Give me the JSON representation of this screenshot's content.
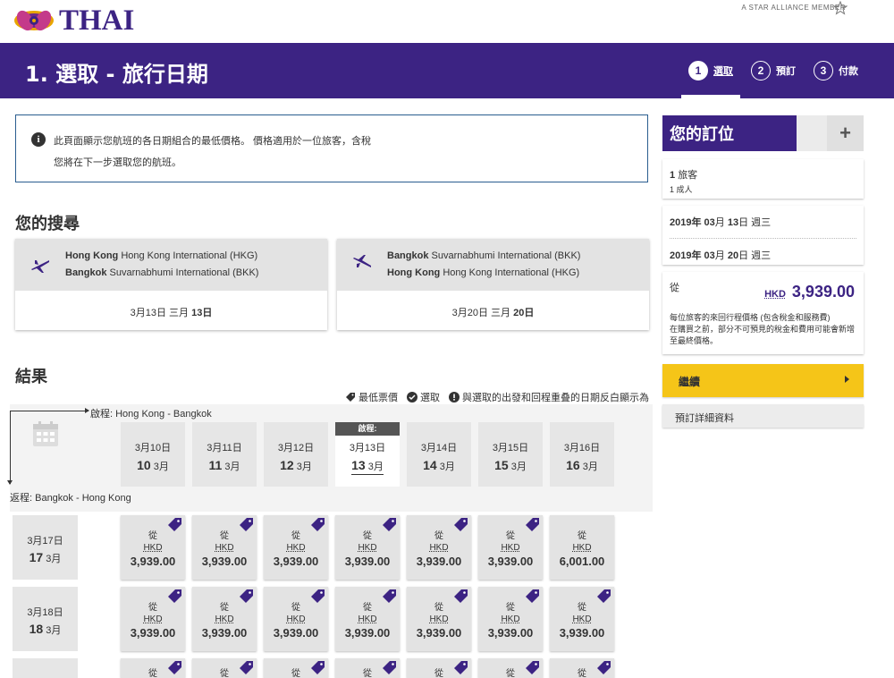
{
  "brand": {
    "name": "THAI",
    "alliance": "A STAR ALLIANCE MEMBER"
  },
  "header": {
    "title": "1. 選取 - 旅行日期",
    "steps": [
      {
        "num": "1",
        "label": "選取"
      },
      {
        "num": "2",
        "label": "預訂"
      },
      {
        "num": "3",
        "label": "付款"
      }
    ]
  },
  "info": {
    "line1": "此頁面顯示您航班的各日期組合的最低價格。 價格適用於一位旅客，含稅",
    "line2": "您將在下一步選取您的航班。"
  },
  "search": {
    "title": "您的搜尋",
    "outbound": {
      "from_city": "Hong Kong",
      "from_airport": "Hong Kong International (HKG)",
      "to_city": "Bangkok",
      "to_airport": "Suvarnabhumi International (BKK)",
      "date_prefix": "3月13日 三月",
      "date_day": "13日"
    },
    "return": {
      "from_city": "Bangkok",
      "from_airport": "Suvarnabhumi International (BKK)",
      "to_city": "Hong Kong",
      "to_airport": "Hong Kong International (HKG)",
      "date_prefix": "3月20日 三月",
      "date_day": "20日"
    }
  },
  "results": {
    "title": "結果",
    "legend": {
      "lowest": "最低票價",
      "selected": "選取",
      "overlap": "與選取的出發和回程重叠的日期反白顯示為"
    },
    "outbound_label": "啟程: Hong Kong - Bangkok",
    "return_label": "返程: Bangkok - Hong Kong",
    "selected_badge": "啟程:",
    "outbound_dates": [
      {
        "d1": "3月10日",
        "day": "10",
        "mon": "3月"
      },
      {
        "d1": "3月11日",
        "day": "11",
        "mon": "3月"
      },
      {
        "d1": "3月12日",
        "day": "12",
        "mon": "3月"
      },
      {
        "d1": "3月13日",
        "day": "13",
        "mon": "3月"
      },
      {
        "d1": "3月14日",
        "day": "14",
        "mon": "3月"
      },
      {
        "d1": "3月15日",
        "day": "15",
        "mon": "3月"
      },
      {
        "d1": "3月16日",
        "day": "16",
        "mon": "3月"
      }
    ],
    "return_dates": [
      {
        "d1": "3月17日",
        "day": "17",
        "mon": "3月"
      },
      {
        "d1": "3月18日",
        "day": "18",
        "mon": "3月"
      }
    ],
    "cell_from": "從",
    "cell_currency": "HKD",
    "prices": [
      [
        "3,939.00",
        "3,939.00",
        "3,939.00",
        "3,939.00",
        "3,939.00",
        "3,939.00",
        "6,001.00"
      ],
      [
        "3,939.00",
        "3,939.00",
        "3,939.00",
        "3,939.00",
        "3,939.00",
        "3,939.00",
        "3,939.00"
      ]
    ],
    "lowest_flags": [
      [
        true,
        true,
        true,
        true,
        true,
        true,
        false
      ],
      [
        true,
        true,
        true,
        true,
        true,
        true,
        true
      ]
    ]
  },
  "booking": {
    "title": "您的訂位",
    "plus": "+",
    "travellers_count": "1",
    "travellers_label": "旅客",
    "travellers_detail": "1 成人",
    "date1_y": "2019年",
    "date1_m": "03",
    "date1_mu": "月",
    "date1_d": "13",
    "date1_du": "日 週三",
    "date2_y": "2019年",
    "date2_m": "03",
    "date2_mu": "月",
    "date2_d": "20",
    "date2_du": "日 週三",
    "from": "從",
    "currency": "HKD",
    "amount": "3,939.00",
    "note1": "每位旅客的來回行程價格 (包含稅金和服務費)",
    "note2": "在購買之前，部分不可預見的稅金和費用可能會新增至最終價格。",
    "continue": "繼續",
    "details": "預訂詳細資料"
  },
  "colors": {
    "brand_purple": "#3c2383",
    "accent_yellow": "#f5c518",
    "info_border": "#2a5d8f"
  }
}
